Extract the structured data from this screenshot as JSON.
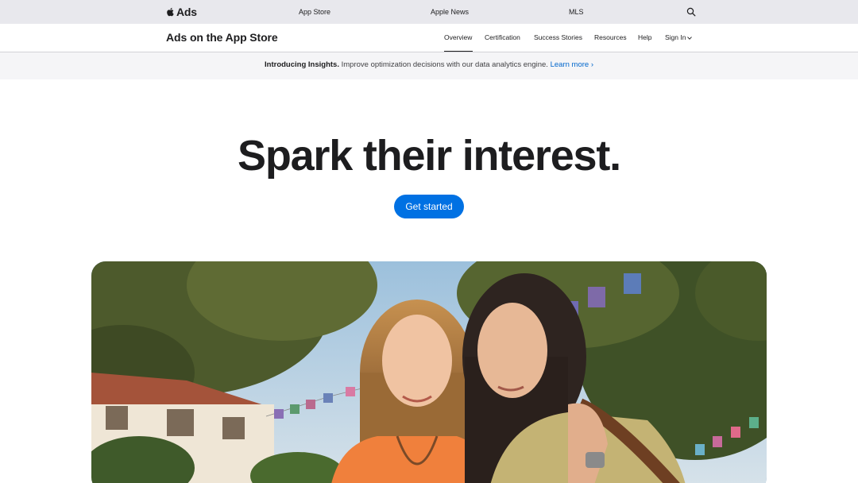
{
  "global_nav": {
    "brand": "Ads",
    "links": [
      "App Store",
      "Apple News",
      "MLS"
    ],
    "icons": {
      "logo": "apple-logo-icon",
      "search": "search-icon"
    }
  },
  "local_nav": {
    "title": "Ads on the App Store",
    "items": [
      {
        "label": "Overview",
        "active": true
      },
      {
        "label": "Certification"
      },
      {
        "label": "Success Stories"
      },
      {
        "label": "Resources"
      },
      {
        "label": "Help"
      },
      {
        "label": "Sign In"
      }
    ],
    "sign_in_icon": "chevron-down-icon"
  },
  "ribbon": {
    "strong": "Introducing Insights.",
    "body": " Improve optimization decisions with our data analytics engine. ",
    "link": "Learn more ›"
  },
  "hero": {
    "title": "Spark their interest.",
    "cta": "Get started"
  },
  "colors": {
    "accent": "#0071e3",
    "link": "#0066cc",
    "text": "#1d1d1f",
    "global_nav_bg": "#e8e8ed",
    "ribbon_bg": "#f5f5f7"
  }
}
